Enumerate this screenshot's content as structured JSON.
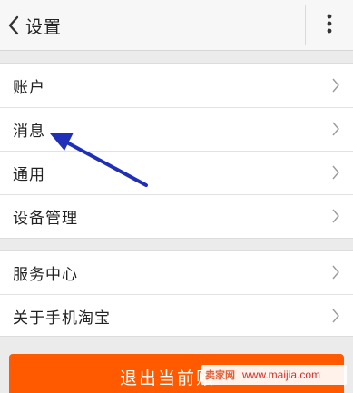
{
  "header": {
    "title": "设置",
    "back_icon": "chevron-left-icon",
    "more_icon": "vertical-ellipsis-icon"
  },
  "settings_group_1": [
    {
      "label": "账户"
    },
    {
      "label": "消息"
    },
    {
      "label": "通用"
    },
    {
      "label": "设备管理"
    }
  ],
  "settings_group_2": [
    {
      "label": "服务中心"
    },
    {
      "label": "关于手机淘宝"
    }
  ],
  "logout_button": {
    "label": "退出当前账"
  },
  "annotation": {
    "color": "#1f2fb8",
    "icon": "arrow-annotation"
  },
  "watermark": {
    "logo": "卖家网",
    "url": "www.maijia.com"
  },
  "colors": {
    "accent": "#ff5a00",
    "background": "#ebebeb"
  }
}
